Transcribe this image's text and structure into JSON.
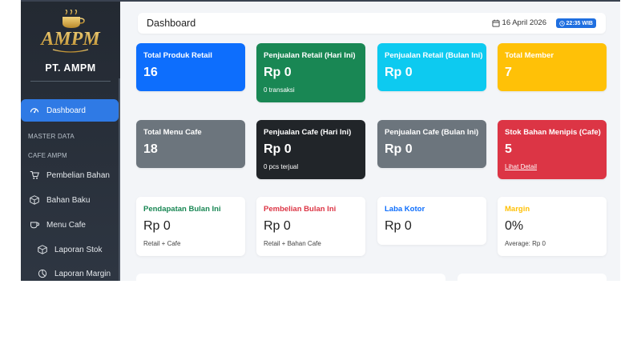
{
  "sidebar": {
    "company": "PT. AMPM",
    "logo_text": "AMPM",
    "items": [
      {
        "label": "Dashboard",
        "icon": "gauge-icon"
      },
      {
        "label": "Pembelian Bahan",
        "icon": "cart-icon"
      },
      {
        "label": "Bahan Baku",
        "icon": "box-icon"
      },
      {
        "label": "Menu Cafe",
        "icon": "cup-icon"
      },
      {
        "label": "Laporan Stok",
        "icon": "box-icon"
      },
      {
        "label": "Laporan Margin",
        "icon": "pie-icon"
      }
    ],
    "sections": [
      "MASTER DATA",
      "CAFE AMPM"
    ]
  },
  "header": {
    "title": "Dashboard",
    "date": "16 April 2026",
    "time": "22:35 WIB"
  },
  "cards": [
    {
      "label": "Total Produk Retail",
      "value": "16",
      "sub": "",
      "color": "#0d6efd"
    },
    {
      "label": "Penjualan Retail (Hari Ini)",
      "value": "Rp 0",
      "sub": "0 transaksi",
      "color": "#198754"
    },
    {
      "label": "Penjualan Retail (Bulan Ini)",
      "value": "Rp 0",
      "sub": "",
      "color": "#0dcaf0"
    },
    {
      "label": "Total Member",
      "value": "7",
      "sub": "",
      "color": "#ffc107"
    },
    {
      "label": "Total Menu Cafe",
      "value": "18",
      "sub": "",
      "color": "#6c757d"
    },
    {
      "label": "Penjualan Cafe (Hari Ini)",
      "value": "Rp 0",
      "sub": "0 pcs terjual",
      "color": "#212529"
    },
    {
      "label": "Penjualan Cafe (Bulan Ini)",
      "value": "Rp 0",
      "sub": "",
      "color": "#6c757d"
    },
    {
      "label": "Stok Bahan Menipis (Cafe)",
      "value": "5",
      "link": "Lihat Detail",
      "color": "#dc3545"
    }
  ],
  "summary": [
    {
      "label": "Pendapatan Bulan Ini",
      "value": "Rp 0",
      "sub": "Retail + Cafe",
      "color": "#198754"
    },
    {
      "label": "Pembelian Bulan Ini",
      "value": "Rp 0",
      "sub": "Retail + Bahan Cafe",
      "color": "#dc3545"
    },
    {
      "label": "Laba Kotor",
      "value": "Rp 0",
      "sub": "",
      "color": "#0d6efd"
    },
    {
      "label": "Margin",
      "value": "0%",
      "sub": "Average: Rp 0",
      "color": "#ffc107"
    }
  ]
}
